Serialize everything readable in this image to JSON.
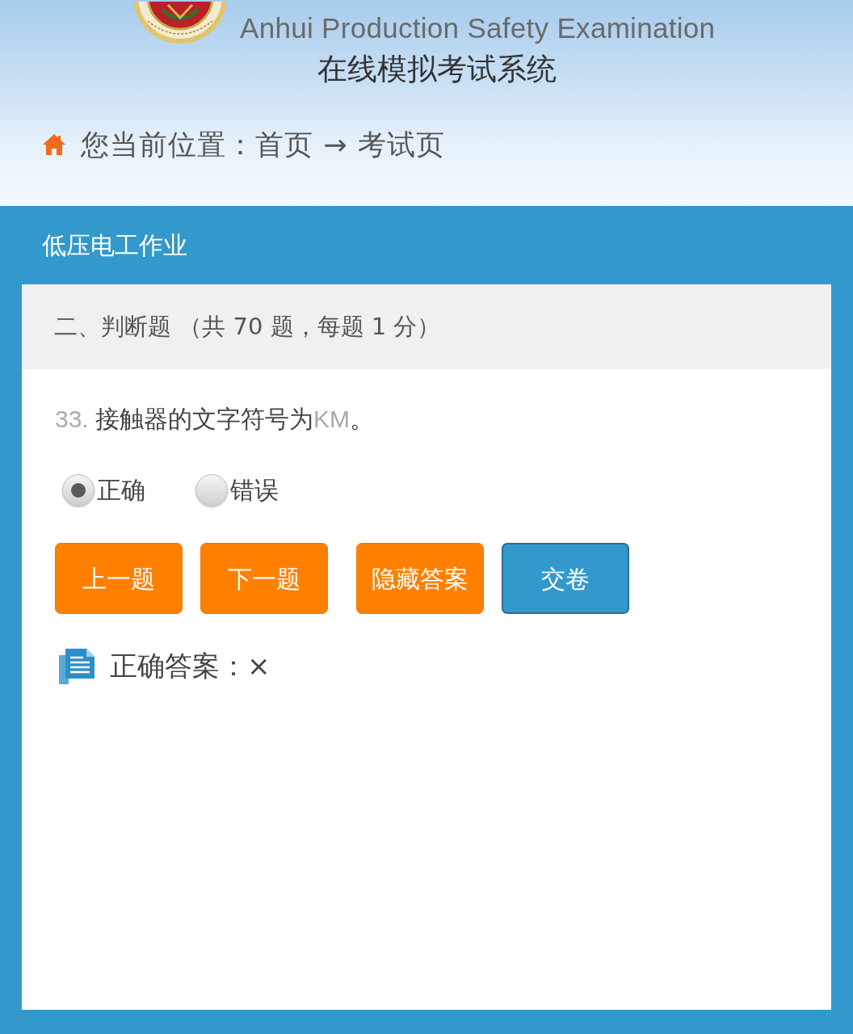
{
  "header": {
    "subtitle": "Anhui Production Safety Examination",
    "system_title": "在线模拟考试系统",
    "breadcrumb": "您当前位置：首页 → 考试页"
  },
  "exam": {
    "title": "低压电工作业",
    "section": "二、判断题 （共 70 题，每题 1 分）",
    "question": {
      "number": "33.",
      "parts": [
        {
          "text": "接触器的文字符号为",
          "muted": false
        },
        {
          "text": "KM",
          "muted": true
        },
        {
          "text": "。",
          "muted": false
        }
      ]
    },
    "options": [
      {
        "label": "正确",
        "selected": true
      },
      {
        "label": "错误",
        "selected": false
      }
    ],
    "buttons": [
      {
        "label": "上一题",
        "kind": "action"
      },
      {
        "label": "下一题",
        "kind": "action"
      },
      {
        "label": "隐藏答案",
        "kind": "action"
      },
      {
        "label": "交卷",
        "kind": "submit"
      }
    ],
    "answer": {
      "label": "正确答案：×"
    }
  }
}
